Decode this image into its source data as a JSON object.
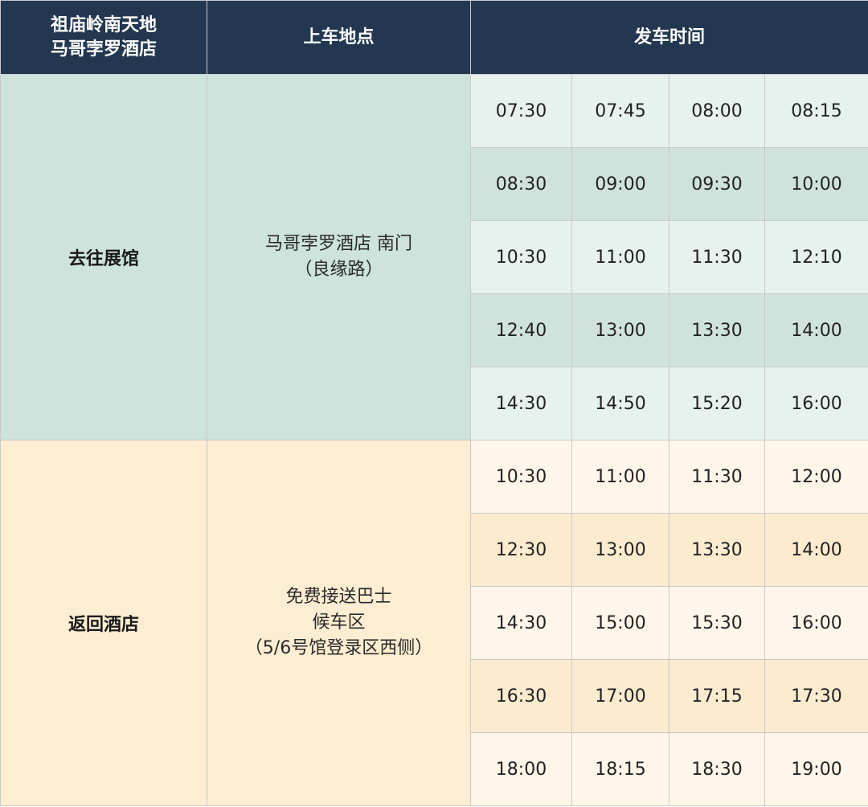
{
  "header": {
    "hotel_line1": "祖庙岭南天地",
    "hotel_line2": "马哥孛罗酒店",
    "pickup_label": "上车地点",
    "times_label": "发车时间"
  },
  "sections": [
    {
      "direction": "去往展馆",
      "location_lines": [
        "马哥孛罗酒店 南门",
        "（良缘路）"
      ],
      "rows": [
        [
          "07:30",
          "07:45",
          "08:00",
          "08:15"
        ],
        [
          "08:30",
          "09:00",
          "09:30",
          "10:00"
        ],
        [
          "10:30",
          "11:00",
          "11:30",
          "12:10"
        ],
        [
          "12:40",
          "13:00",
          "13:30",
          "14:00"
        ],
        [
          "14:30",
          "14:50",
          "15:20",
          "16:00"
        ]
      ]
    },
    {
      "direction": "返回酒店",
      "location_lines": [
        "免费接送巴士",
        "候车区",
        "（5/6号馆登录区西侧）"
      ],
      "rows": [
        [
          "10:30",
          "11:00",
          "11:30",
          "12:00"
        ],
        [
          "12:30",
          "13:00",
          "13:30",
          "14:00"
        ],
        [
          "14:30",
          "15:00",
          "15:30",
          "16:00"
        ],
        [
          "16:30",
          "17:00",
          "17:15",
          "17:30"
        ],
        [
          "18:00",
          "18:15",
          "18:30",
          "19:00"
        ]
      ]
    }
  ],
  "colors": {
    "header_bg": "#233750",
    "outbound_span": "#cde3dc",
    "outbound_light": "#e7f1ed",
    "outbound_dark": "#cfe3dc",
    "return_span": "#fdedd2",
    "return_light": "#fff6e9",
    "return_dark": "#fcebcf"
  }
}
